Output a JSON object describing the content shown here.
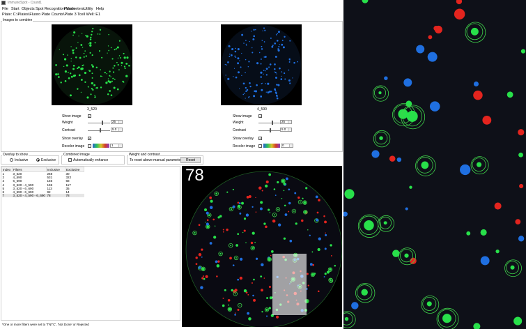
{
  "window": {
    "title": "ImmunoSpot - Count1"
  },
  "menu": [
    "File",
    "Start",
    "Objects",
    "Spot Recognition Mode",
    "Parameters",
    "Utility",
    "Help"
  ],
  "plate_path": "Plate: C:\\Plates\\Fluoro Plate Counts\\Plate 3 Tcell Well: E1",
  "images_to_combine": {
    "label": "Images to combine",
    "left": {
      "name": "3_520",
      "show_image_label": "Show image",
      "show_image": true,
      "weight_label": "Weight",
      "weight": "25",
      "contrast_label": "Contrast",
      "contrast": "5.0",
      "show_overlay_label": "Show overlay",
      "show_overlay": true,
      "recolor_label": "Recolor image",
      "recolor": false,
      "recolor_value": "1",
      "color": "#1dbf2a"
    },
    "right": {
      "name": "4_590",
      "show_image_label": "Show image",
      "show_image": true,
      "weight_label": "Weight",
      "weight": "25",
      "contrast_label": "Contrast",
      "contrast": "5.0",
      "show_overlay_label": "Show overlay",
      "show_overlay": true,
      "recolor_label": "Recolor image",
      "recolor": false,
      "recolor_value": "0",
      "color": "#2f7fd6"
    }
  },
  "overlay_to_show": {
    "label": "Overlay to show",
    "inclusive": "Inclusive",
    "exclusive": "Exclusive",
    "selected": "exclusive"
  },
  "combined_image": {
    "label": "Combined image",
    "auto_enhance": "Automatically enhance",
    "checked": true
  },
  "weight_contrast": {
    "label": "Weight and contrast",
    "hint": "To reset above manual parameters:",
    "reset": "Reset"
  },
  "results_table": {
    "headers": [
      "Index",
      "Filters",
      "Inclusive",
      "Exclusive"
    ],
    "rows": [
      [
        "1",
        "3_520",
        "268",
        "30"
      ],
      [
        "2",
        "4_590",
        "531",
        "322"
      ],
      [
        "3",
        "6_690",
        "156",
        "68"
      ],
      [
        "4",
        "3_520 - 4_590",
        "196",
        "117"
      ],
      [
        "5",
        "3_520 - 6_690",
        "113",
        "35"
      ],
      [
        "6",
        "4_590 - 6_690",
        "92",
        "14"
      ],
      [
        "7",
        "3_520 - 4_590 - 6_690",
        "78",
        "78"
      ]
    ],
    "selected_index": 6
  },
  "combined_view": {
    "count": "78"
  },
  "footnote": "*One or more filters were set to 'TNTC', 'Not Done' or Rejected",
  "colors": {
    "green": "#28e04a",
    "blue": "#1f6fe0",
    "red": "#e3241e",
    "overlay_ring": "#3fd34a"
  }
}
